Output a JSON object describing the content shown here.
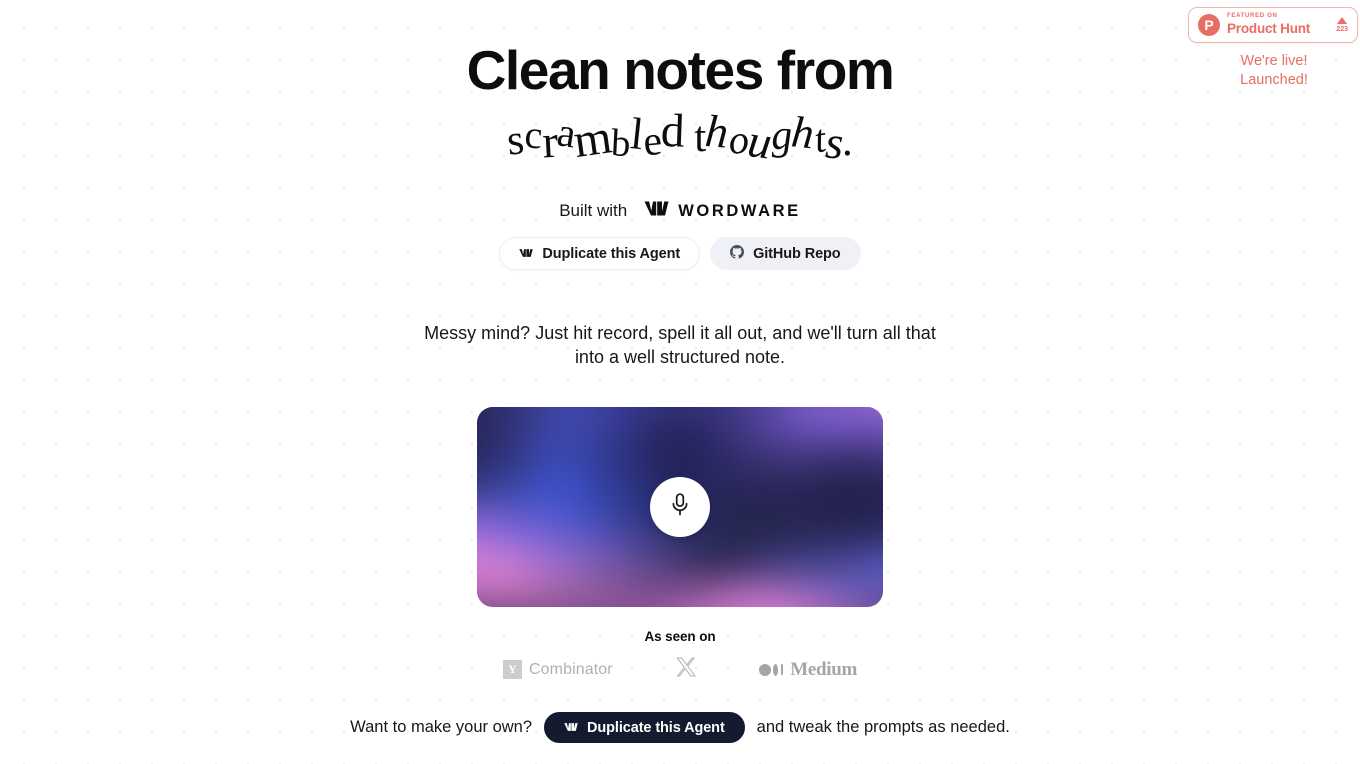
{
  "product_hunt": {
    "featured_label": "FEATURED ON",
    "name": "Product Hunt",
    "logo_letter": "P",
    "upvote_count": "223",
    "status_line_1": "We're live!",
    "status_line_2": "Launched!",
    "accent_color": "#ea6d62",
    "border_color": "#f3b5ae"
  },
  "hero": {
    "headline": "Clean notes from",
    "headline_accent": "scrambled thoughts.",
    "built_with_label": "Built with",
    "wordware_name": "WORDWARE",
    "subtitle": "Messy mind? Just hit record, spell it all out, and we'll turn all that into a well structured note.",
    "buttons": [
      {
        "label": "Duplicate this Agent",
        "icon": "wordware-icon",
        "style": "white"
      },
      {
        "label": "GitHub Repo",
        "icon": "github-icon",
        "style": "grey"
      }
    ]
  },
  "recorder": {
    "mic_icon": "microphone-icon",
    "base_color": "#2b2b54",
    "accent_colors": [
      "#7a6eff",
      "#4664ff",
      "#ff8cdc",
      "#9a6eff"
    ]
  },
  "as_seen_on": {
    "label": "As seen on",
    "logos": [
      {
        "name": "ycombinator-logo",
        "mark": "Y",
        "word": "Combinator"
      },
      {
        "name": "x-logo",
        "mark": "X",
        "word": ""
      },
      {
        "name": "medium-logo",
        "mark": "",
        "word": "Medium"
      }
    ]
  },
  "footer": {
    "lead_text": "Want to make your own?",
    "button_label": "Duplicate this Agent",
    "button_icon": "wordware-icon",
    "trail_text": "and tweak the prompts as needed."
  }
}
